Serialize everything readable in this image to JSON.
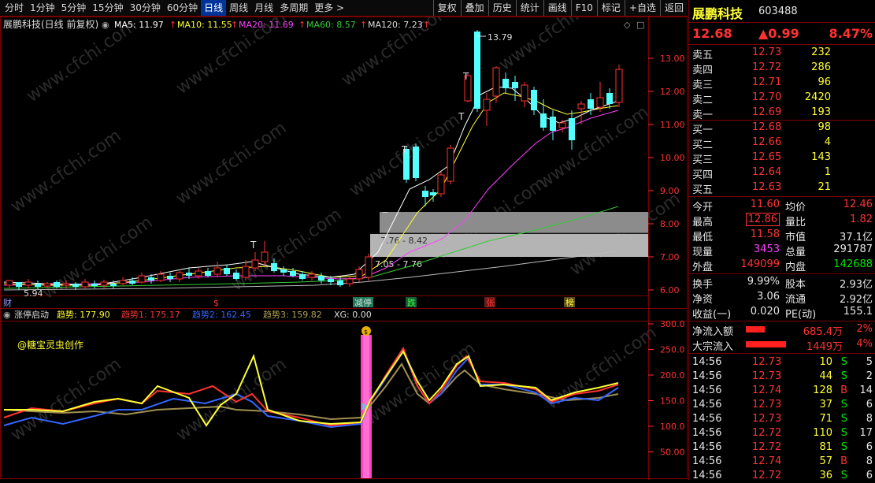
{
  "toolbar": {
    "periods": [
      "分时",
      "1分钟",
      "5分钟",
      "15分钟",
      "30分钟",
      "60分钟",
      "日线",
      "周线",
      "月线",
      "多周期",
      "更多 >"
    ],
    "active_period": "日线",
    "buttons": [
      "复权",
      "叠加",
      "历史",
      "统计",
      "画线",
      "F10",
      "标记",
      "+自选",
      "返回"
    ]
  },
  "chart": {
    "title": "展鹏科技(日线 前复权)",
    "ma": [
      {
        "label": "MA5: 11.97",
        "color": "#ffffff"
      },
      {
        "label": "MA10: 11.55",
        "color": "#ffff33"
      },
      {
        "label": "MA20: 11.69",
        "color": "#ff40ff"
      },
      {
        "label": "MA60: 8.57",
        "color": "#33cc33"
      },
      {
        "label": "MA120: 7.23",
        "color": "#dddddd"
      }
    ],
    "price_axis": [
      "13.00",
      "12.00",
      "11.00",
      "10.00",
      "9.00",
      "8.00",
      "7.00",
      "6.00"
    ],
    "annotations": {
      "high": "13.79",
      "low": "5.94",
      "zone_upper": "7.76 - 8.42",
      "zone_lower": "7.05 - 7.76"
    },
    "event_markers": [
      "财",
      "$",
      "减停",
      "跌",
      "张",
      "榜"
    ],
    "watermark": "www.cfchi.com"
  },
  "indicator": {
    "name": "涨停启动",
    "values": [
      {
        "label": "趋势: 177.90",
        "color": "#ffff33"
      },
      {
        "label": "趋势1: 175.17",
        "color": "#ff3232"
      },
      {
        "label": "趋势2: 162.45",
        "color": "#3366ff"
      },
      {
        "label": "趋势3: 159.82",
        "color": "#b0a050"
      },
      {
        "label": "XG: 0.00",
        "color": "#dddddd"
      }
    ],
    "axis": [
      "300.0",
      "250.0",
      "200.0",
      "150.0",
      "100.0",
      "50.00"
    ],
    "credit": "@糖宝灵虫创作"
  },
  "quote": {
    "name": "展鹏科技",
    "code": "603488",
    "price": "12.68",
    "change": "▲0.99",
    "change_pct": "8.47%",
    "asks": [
      {
        "label": "卖五",
        "price": "12.73",
        "vol": "232"
      },
      {
        "label": "卖四",
        "price": "12.72",
        "vol": "286"
      },
      {
        "label": "卖三",
        "price": "12.71",
        "vol": "96"
      },
      {
        "label": "卖二",
        "price": "12.70",
        "vol": "2420"
      },
      {
        "label": "卖一",
        "price": "12.69",
        "vol": "193"
      }
    ],
    "bids": [
      {
        "label": "买一",
        "price": "12.68",
        "vol": "98"
      },
      {
        "label": "买二",
        "price": "12.66",
        "vol": "4"
      },
      {
        "label": "买三",
        "price": "12.65",
        "vol": "143"
      },
      {
        "label": "买四",
        "price": "12.64",
        "vol": "1"
      },
      {
        "label": "买五",
        "price": "12.63",
        "vol": "21"
      }
    ],
    "stats": [
      {
        "l1": "今开",
        "v1": "11.60",
        "c1": "red",
        "l2": "均价",
        "v2": "12.46",
        "c2": "red"
      },
      {
        "l1": "最高",
        "v1": "12.86",
        "c1": "red",
        "l2": "量比",
        "v2": "1.82",
        "c2": "red"
      },
      {
        "l1": "最低",
        "v1": "11.58",
        "c1": "red",
        "l2": "市值",
        "v2": "37.1亿",
        "c2": "white"
      },
      {
        "l1": "现量",
        "v1": "3453",
        "c1": "magenta",
        "l2": "总量",
        "v2": "291787",
        "c2": "white"
      },
      {
        "l1": "外盘",
        "v1": "149099",
        "c1": "red",
        "l2": "内盘",
        "v2": "142688",
        "c2": "green"
      }
    ],
    "stats2": [
      {
        "l1": "换手",
        "v1": "9.99%",
        "l2": "股本",
        "v2": "2.93亿"
      },
      {
        "l1": "净资",
        "v1": "3.06",
        "l2": "流通",
        "v2": "2.92亿"
      },
      {
        "l1": "收益(一)",
        "v1": "0.020",
        "l2": "PE(动)",
        "v2": "155.1"
      }
    ],
    "flows": [
      {
        "label": "净流入额",
        "value": "685.4万",
        "pct": "2%",
        "bar": 0.32
      },
      {
        "label": "大宗流入",
        "value": "1449万",
        "pct": "4%",
        "bar": 0.68
      }
    ],
    "ticks": [
      {
        "time": "14:56",
        "price": "12.73",
        "vol": "10",
        "side": "S",
        "n": "5"
      },
      {
        "time": "14:56",
        "price": "12.73",
        "vol": "44",
        "side": "S",
        "n": "2"
      },
      {
        "time": "14:56",
        "price": "12.74",
        "vol": "128",
        "side": "B",
        "n": "14"
      },
      {
        "time": "14:56",
        "price": "12.73",
        "vol": "37",
        "side": "S",
        "n": "6"
      },
      {
        "time": "14:56",
        "price": "12.73",
        "vol": "71",
        "side": "S",
        "n": "8"
      },
      {
        "time": "14:56",
        "price": "12.72",
        "vol": "110",
        "side": "S",
        "n": "17"
      },
      {
        "time": "14:56",
        "price": "12.72",
        "vol": "81",
        "side": "S",
        "n": "6"
      },
      {
        "time": "14:56",
        "price": "12.74",
        "vol": "57",
        "side": "B",
        "n": "8"
      },
      {
        "time": "14:56",
        "price": "12.72",
        "vol": "36",
        "side": "S",
        "n": "6"
      }
    ]
  }
}
